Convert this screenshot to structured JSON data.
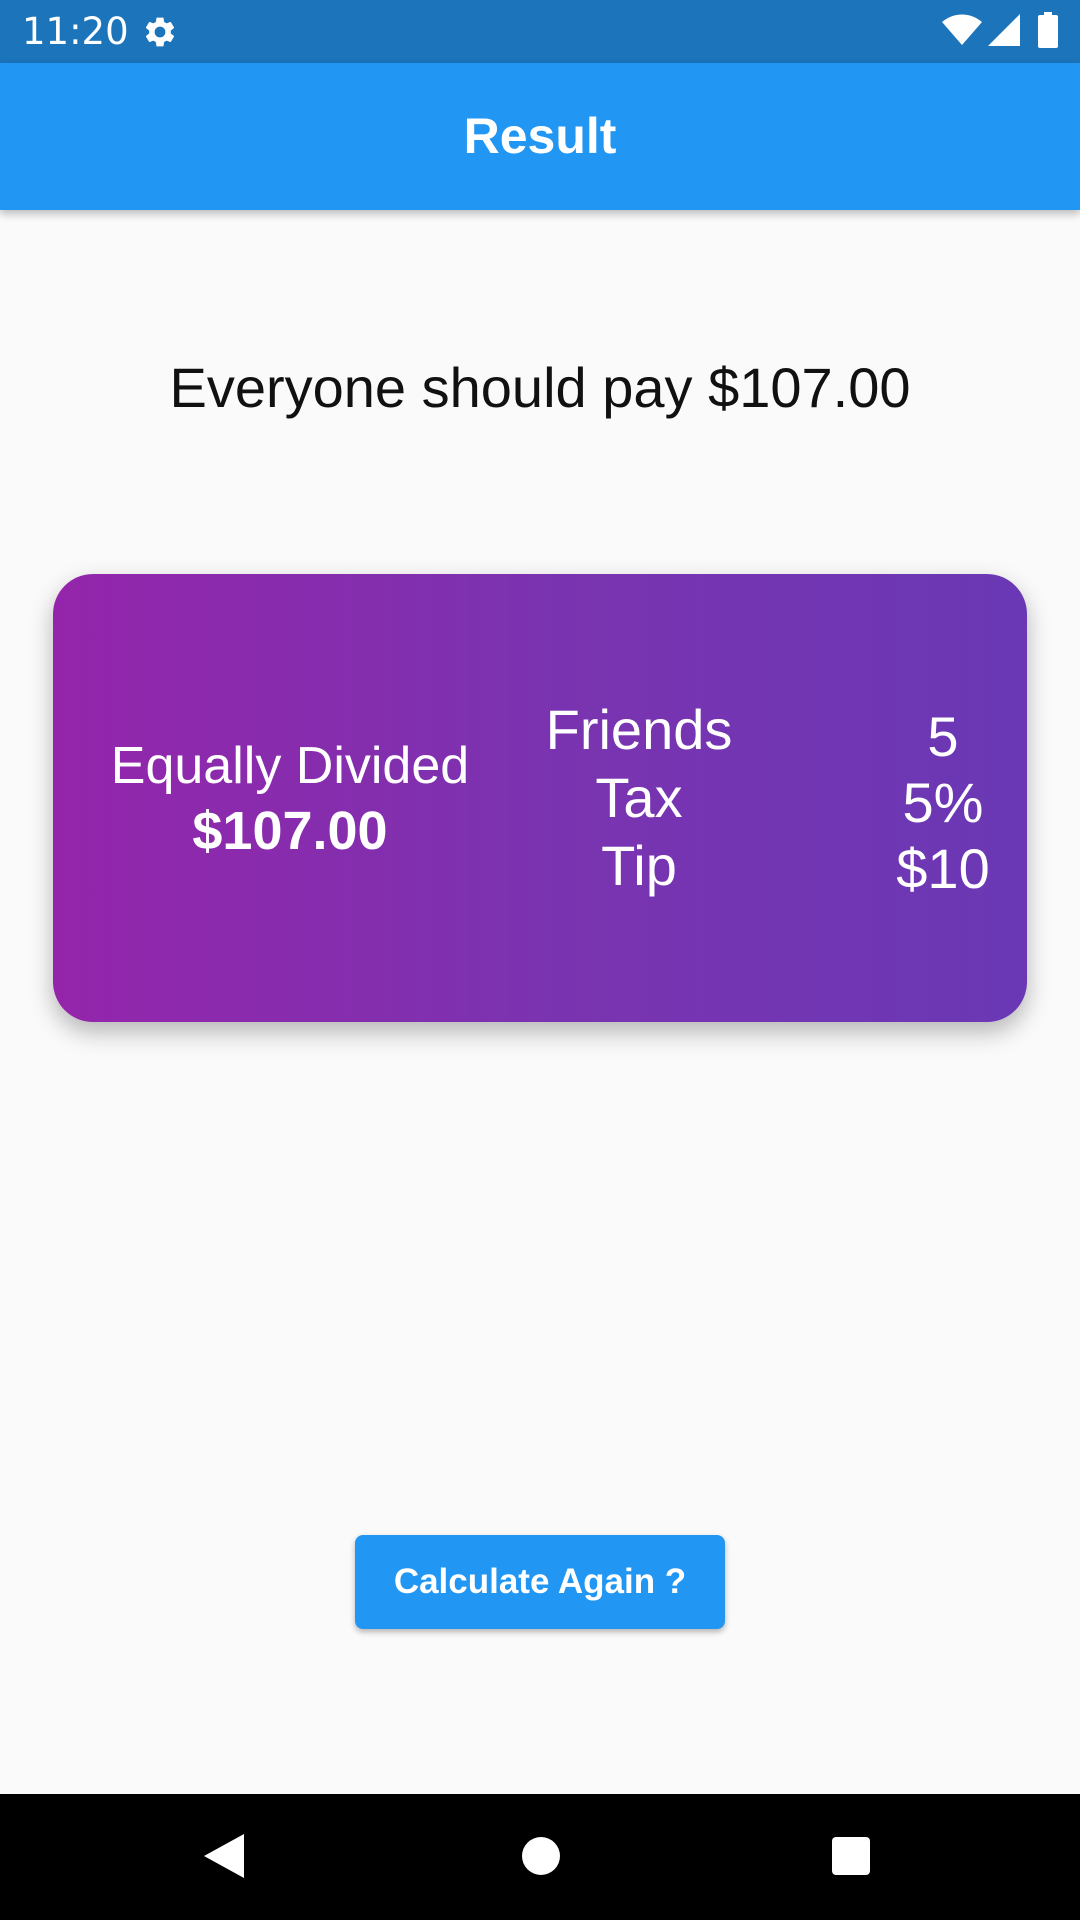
{
  "status_bar": {
    "time": "11:20",
    "icons": [
      "gear-icon",
      "wifi-icon",
      "signal-icon",
      "battery-icon"
    ]
  },
  "app_bar": {
    "title": "Result",
    "color": "#2196f3"
  },
  "headline": "Everyone should pay $107.00",
  "summary_card": {
    "split_label": "Equally Divided",
    "split_amount": "$107.00",
    "rows": [
      {
        "label": "Friends",
        "value": "5"
      },
      {
        "label": "Tax",
        "value": "5%"
      },
      {
        "label": "Tip",
        "value": "$10"
      }
    ],
    "gradient_colors": [
      "#9425ab",
      "#6a38b5"
    ]
  },
  "action_button": {
    "label": "Calculate Again ?"
  },
  "nav_bar": {
    "icons": [
      "back-icon",
      "home-icon",
      "recents-icon"
    ]
  }
}
